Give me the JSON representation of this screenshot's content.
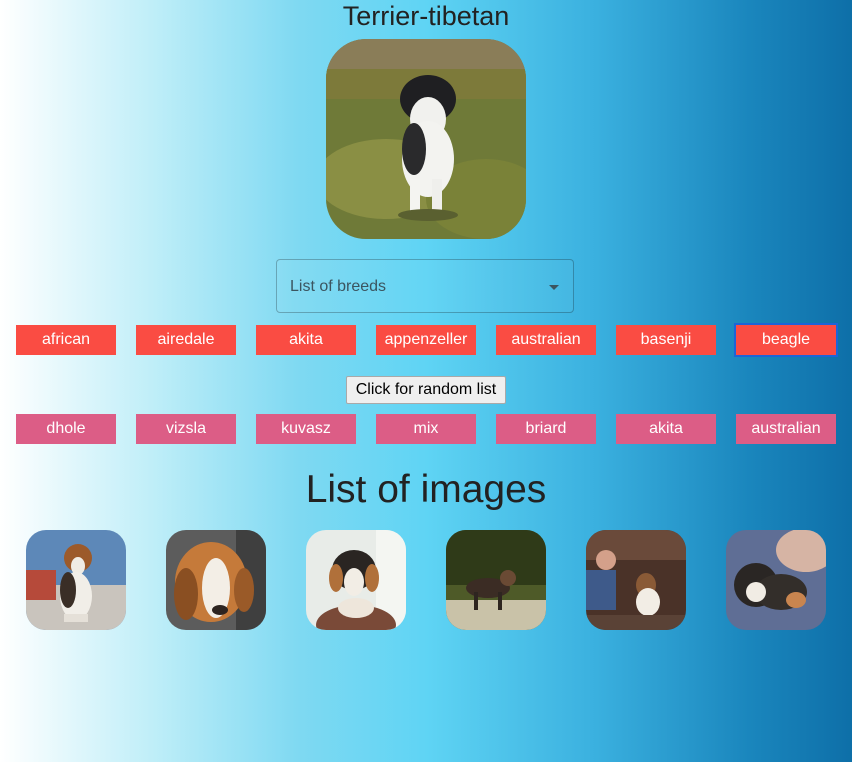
{
  "header": {
    "title": "Terrier-tibetan"
  },
  "hero_image": {
    "alt": "Terrier-tibetan"
  },
  "breed_select": {
    "placeholder": "List of breeds"
  },
  "breed_buttons": [
    "african",
    "airedale",
    "akita",
    "appenzeller",
    "australian",
    "basenji",
    "beagle"
  ],
  "active_breed": "beagle",
  "random_button": {
    "label": "Click for random list"
  },
  "random_breeds": [
    "dhole",
    "vizsla",
    "kuvasz",
    "mix",
    "briard",
    "akita",
    "australian"
  ],
  "images_section": {
    "title": "List of images"
  },
  "colors": {
    "breed_button": "#fa4c43",
    "random_breed_button": "#dc5d86",
    "focus_ring": "#1c64d8",
    "text": "#222222"
  }
}
